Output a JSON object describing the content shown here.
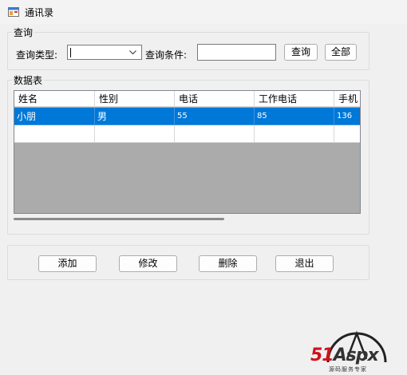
{
  "window": {
    "title": "通讯录"
  },
  "query": {
    "group_label": "查询",
    "type_label": "查询类型:",
    "condition_label": "查询条件:",
    "search_button": "查询",
    "all_button": "全部"
  },
  "data_group": {
    "label": "数据表"
  },
  "table": {
    "columns": [
      "姓名",
      "性别",
      "电话",
      "工作电话",
      "手机"
    ],
    "rows": [
      [
        "小朋",
        "男",
        "55",
        "85",
        "136"
      ]
    ]
  },
  "actions": {
    "add_button": "添加",
    "edit_button": "修改",
    "delete_button": "删除",
    "exit_button": "退出"
  },
  "watermark": {
    "logo_red": "51",
    "logo_dark": "Aspx",
    "tagline": "源码服务专家"
  },
  "colors": {
    "selection": "#0078d7",
    "window_bg": "#f0f0f0",
    "grid_bg": "#ababab"
  }
}
